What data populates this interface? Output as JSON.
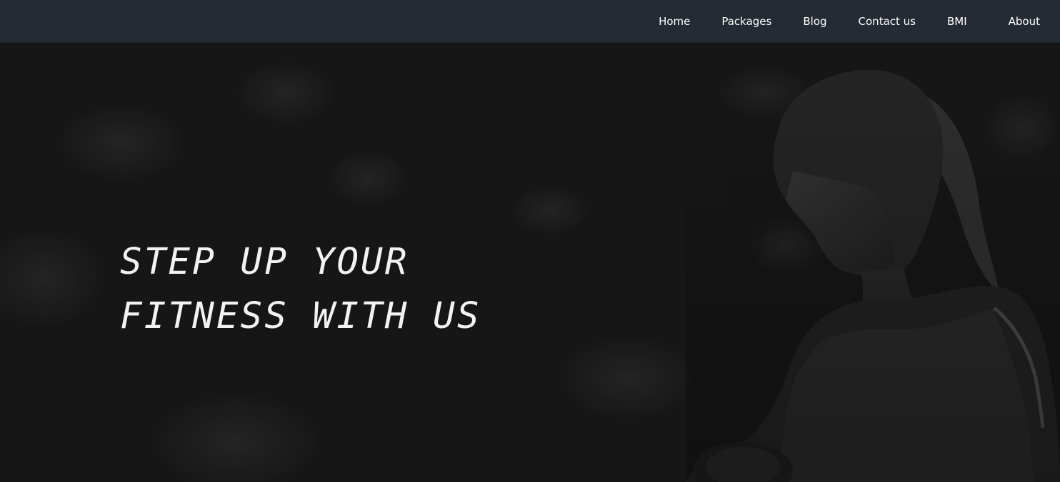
{
  "nav": {
    "items": [
      {
        "label": "Home"
      },
      {
        "label": "Packages"
      },
      {
        "label": "Blog"
      },
      {
        "label": "Contact us"
      },
      {
        "label": "BMI"
      },
      {
        "label": "About"
      }
    ]
  },
  "hero": {
    "title_line_1": "STEP UP YOUR",
    "title_line_2": "FITNESS WITH US",
    "background_image": "woman-with-dumbbell-photo"
  },
  "colors": {
    "navbar_bg": "#252b34",
    "hero_bg": "#1c1c1c",
    "text": "#ffffff"
  }
}
